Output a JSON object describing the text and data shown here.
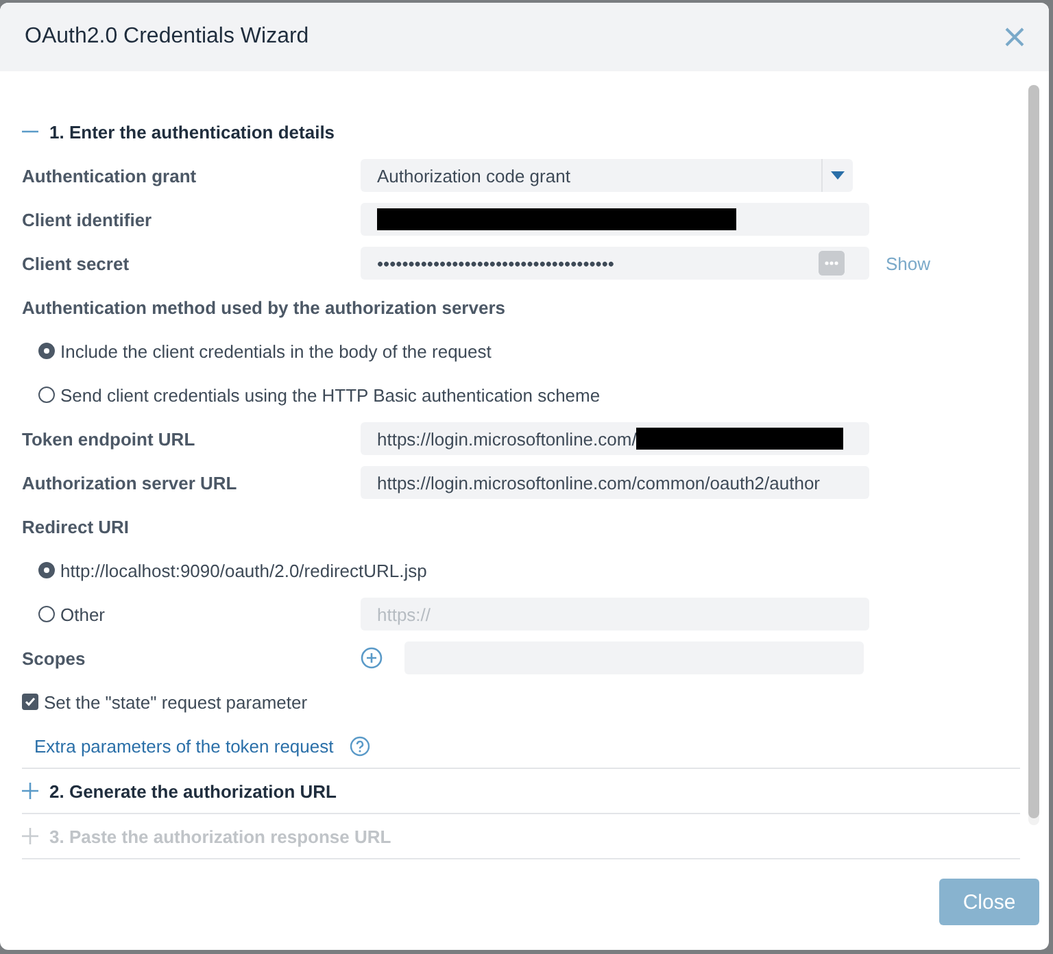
{
  "dialog": {
    "title": "OAuth2.0 Credentials Wizard"
  },
  "sections": [
    {
      "title": "1. Enter the authentication details",
      "expanded": true,
      "disabled": false,
      "items": [
        {
          "kind": "select",
          "label": "Authentication grant",
          "value": "Authorization code grant"
        },
        {
          "kind": "redacted",
          "label": "Client identifier"
        },
        {
          "kind": "password",
          "label": "Client secret",
          "value": "••••••••••••••••••••••••••••••••••••••",
          "action": "Show"
        },
        {
          "kind": "heading",
          "label": "Authentication method used by the authorization servers"
        },
        {
          "kind": "radio",
          "label": "Include the client credentials in the body of the request",
          "selected": true
        },
        {
          "kind": "radio",
          "label": "Send client credentials using the HTTP Basic authentication scheme",
          "selected": false
        },
        {
          "kind": "partly-redacted",
          "label": "Token endpoint URL",
          "value": "https://login.microsoftonline.com/"
        },
        {
          "kind": "text",
          "label": "Authorization server URL",
          "value": "https://login.microsoftonline.com/common/oauth2/author"
        },
        {
          "kind": "heading",
          "label": "Redirect URI"
        },
        {
          "kind": "radio",
          "label": "http://localhost:9090/oauth/2.0/redirectURL.jsp",
          "selected": true
        },
        {
          "kind": "radio-field",
          "label": "Other",
          "selected": false,
          "placeholder": "https://"
        },
        {
          "kind": "scopes",
          "label": "Scopes"
        },
        {
          "kind": "checkbox",
          "label": "Set the \"state\" request parameter",
          "checked": true
        },
        {
          "kind": "link",
          "label": "Extra parameters of the token request"
        }
      ]
    },
    {
      "title": "2. Generate the authorization URL",
      "expanded": false,
      "disabled": false
    },
    {
      "title": "3. Paste the authorization response URL",
      "expanded": false,
      "disabled": true
    }
  ],
  "footer": {
    "close": "Close"
  }
}
